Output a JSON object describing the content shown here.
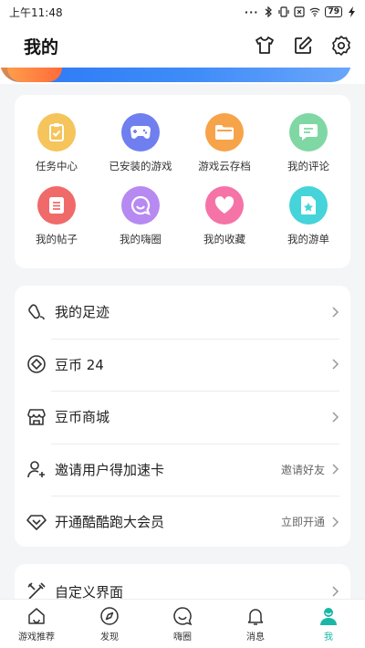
{
  "status_bar": {
    "time": "上午11:48",
    "battery": "79"
  },
  "header": {
    "title": "我的"
  },
  "grid": [
    {
      "label": "任务中心",
      "icon": "task-clipboard-icon",
      "color": "#f5c45b"
    },
    {
      "label": "已安装的游戏",
      "icon": "gamepad-icon",
      "color": "#6f7ff0"
    },
    {
      "label": "游戏云存档",
      "icon": "folder-icon",
      "color": "#f7a34a"
    },
    {
      "label": "我的评论",
      "icon": "comment-icon",
      "color": "#7fd8a4"
    },
    {
      "label": "我的帖子",
      "icon": "post-document-icon",
      "color": "#f06a6a"
    },
    {
      "label": "我的嗨圈",
      "icon": "smile-bubble-icon",
      "color": "#b78af2"
    },
    {
      "label": "我的收藏",
      "icon": "heart-icon",
      "color": "#f573a6"
    },
    {
      "label": "我的游单",
      "icon": "game-list-icon",
      "color": "#45d4d9"
    }
  ],
  "menu": [
    {
      "label": "我的足迹",
      "extra": "",
      "icon": "footprint-icon"
    },
    {
      "label": "豆币 24",
      "extra": "",
      "icon": "coin-icon"
    },
    {
      "label": "豆币商城",
      "extra": "",
      "icon": "store-icon"
    },
    {
      "label": "邀请用户得加速卡",
      "extra": "邀请好友",
      "icon": "invite-user-icon"
    },
    {
      "label": "开通酷酷跑大会员",
      "extra": "立即开通",
      "icon": "vip-diamond-icon"
    }
  ],
  "custom_row": {
    "label": "自定义界面",
    "icon": "customize-tools-icon"
  },
  "tabs": [
    {
      "label": "游戏推荐",
      "icon": "home-icon",
      "active": false
    },
    {
      "label": "发现",
      "icon": "compass-icon",
      "active": false
    },
    {
      "label": "嗨圈",
      "icon": "smile-bubble-icon",
      "active": false
    },
    {
      "label": "消息",
      "icon": "bell-icon",
      "active": false
    },
    {
      "label": "我",
      "icon": "profile-icon",
      "active": true
    }
  ],
  "colors": {
    "accent": "#19b8a6",
    "banner": "#2f7cf6"
  }
}
